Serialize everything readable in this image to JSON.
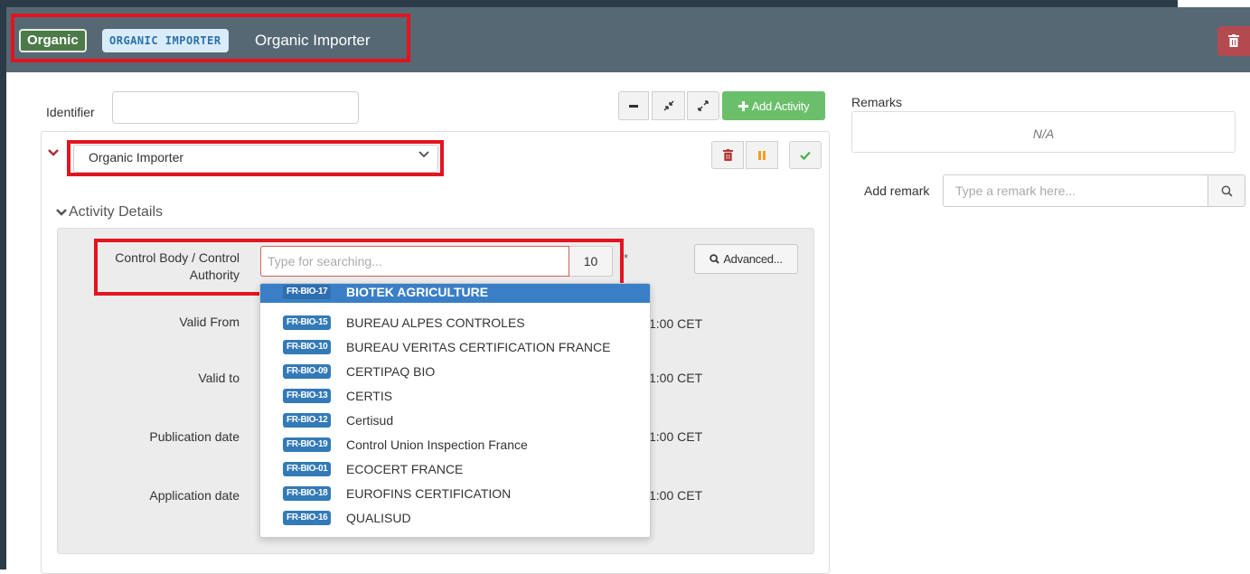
{
  "header": {
    "badge_label": "Organic",
    "code_label": "ORGANIC IMPORTER",
    "title": "Organic Importer",
    "delete_icon": "trash-icon"
  },
  "toolbar": {
    "add_activity_label": "Add Activity",
    "collapse_icon": "minus-icon",
    "compress_icon": "compress-icon",
    "expand_icon": "expand-icon"
  },
  "form": {
    "identifier_label": "Identifier",
    "identifier_value": ""
  },
  "activity": {
    "selected": "Organic Importer",
    "details_label": "Activity Details",
    "control_body_label": "Control Body / Control Authority",
    "search_placeholder": "Type for searching...",
    "result_count": "10",
    "required_mark": "*",
    "advanced_label": "Advanced...",
    "rows": [
      {
        "label": "Valid From",
        "tz": "1:00 CET"
      },
      {
        "label": "Valid to",
        "tz": "1:00 CET"
      },
      {
        "label": "Publication date",
        "tz": "1:00 CET"
      },
      {
        "label": "Application date",
        "tz": "1:00 CET"
      }
    ]
  },
  "dropdown": {
    "items": [
      {
        "code": "FR-BIO-17",
        "name": "BIOTEK AGRICULTURE",
        "active": true
      },
      {
        "code": "FR-BIO-15",
        "name": "BUREAU ALPES CONTROLES"
      },
      {
        "code": "FR-BIO-10",
        "name": "BUREAU VERITAS CERTIFICATION FRANCE"
      },
      {
        "code": "FR-BIO-09",
        "name": "CERTIPAQ BIO"
      },
      {
        "code": "FR-BIO-13",
        "name": "CERTIS"
      },
      {
        "code": "FR-BIO-12",
        "name": "Certisud"
      },
      {
        "code": "FR-BIO-19",
        "name": "Control Union Inspection France"
      },
      {
        "code": "FR-BIO-01",
        "name": "ECOCERT FRANCE"
      },
      {
        "code": "FR-BIO-18",
        "name": "EUROFINS CERTIFICATION"
      },
      {
        "code": "FR-BIO-16",
        "name": "QUALISUD"
      }
    ]
  },
  "remarks": {
    "label": "Remarks",
    "value": "N/A",
    "add_label": "Add remark",
    "add_placeholder": "Type a remark here..."
  },
  "colors": {
    "header_bg": "#566874",
    "badge_green": "#4c7a49",
    "highlight_red": "#e2141f",
    "dropdown_active": "#3a7fc6",
    "add_button": "#6bbf6b"
  }
}
